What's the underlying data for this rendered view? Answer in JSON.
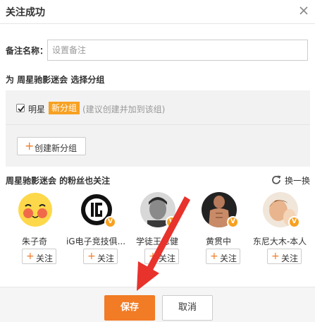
{
  "dialog": {
    "title": "关注成功",
    "close_icon": "close-icon"
  },
  "remark": {
    "label": "备注名称：",
    "placeholder": "设置备注",
    "value": ""
  },
  "group": {
    "title": "为 周星驰影迷会 选择分组",
    "items": [
      {
        "name": "明星",
        "checked": true,
        "badge": "新分组",
        "hint": "(建议创建并加到该组)"
      }
    ],
    "create_label": "创建新分组"
  },
  "fans": {
    "title": "周星驰影迷会 的粉丝也关注",
    "refresh_label": "换一换",
    "users": [
      {
        "name": "朱子奇",
        "follow_label": "关注",
        "verified": false
      },
      {
        "name": "iG电子竞技俱...",
        "follow_label": "关注",
        "verified": true
      },
      {
        "name": "学徒王恩健",
        "follow_label": "关注",
        "verified": true
      },
      {
        "name": "黄贯中",
        "follow_label": "关注",
        "verified": true
      },
      {
        "name": "东尼大木-本人",
        "follow_label": "关注",
        "verified": true
      }
    ]
  },
  "footer": {
    "save_label": "保存",
    "cancel_label": "取消"
  },
  "colors": {
    "accent": "#f27b25",
    "badge": "#f7a121",
    "annotation_arrow": "#e8322c"
  }
}
